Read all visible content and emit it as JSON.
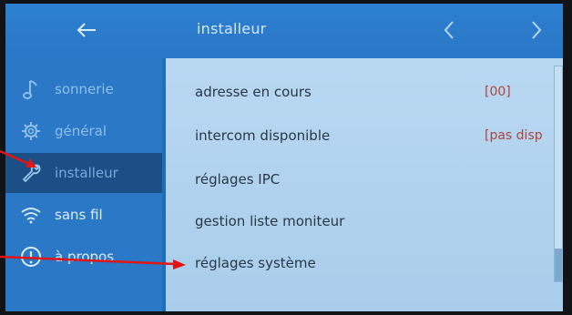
{
  "header": {
    "title": "installeur",
    "back_icon": "arrow-left-icon",
    "prev_icon": "chevron-left-icon",
    "next_icon": "chevron-right-icon"
  },
  "sidebar": {
    "items": [
      {
        "label": "sonnerie",
        "icon": "music-note-icon"
      },
      {
        "label": "général",
        "icon": "gear-icon"
      },
      {
        "label": "installeur",
        "icon": "wrench-icon",
        "active": true
      },
      {
        "label": "sans fil",
        "icon": "wifi-icon"
      },
      {
        "label": "à propos",
        "icon": "info-icon"
      }
    ]
  },
  "content": {
    "rows": [
      {
        "label": "adresse en cours",
        "value": "[00]"
      },
      {
        "label": "intercom disponible",
        "value": "[pas disp"
      },
      {
        "label": "réglages IPC",
        "value": ""
      },
      {
        "label": "gestion liste moniteur",
        "value": ""
      },
      {
        "label": "réglages système",
        "value": ""
      }
    ]
  },
  "colors": {
    "screen_blue": "#2a78c6",
    "active_item": "#1b4f86",
    "content_bg": "#b9d8f2",
    "value_red": "#b0443e",
    "annotation_arrow": "#e01515"
  }
}
